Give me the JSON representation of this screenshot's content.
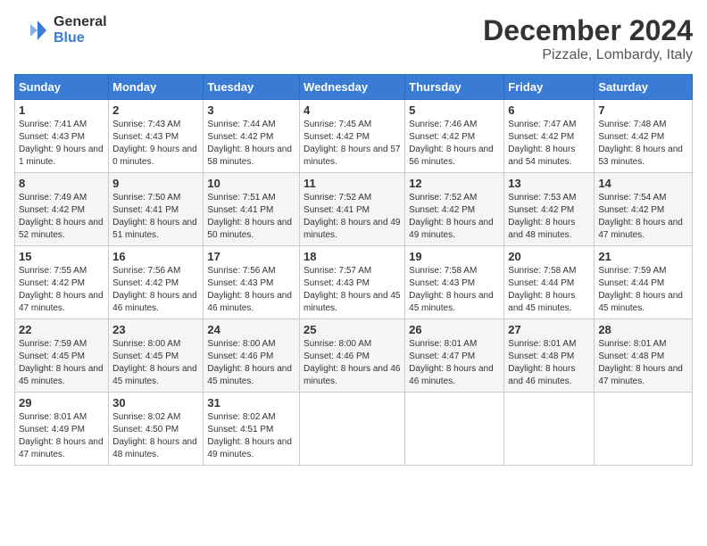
{
  "header": {
    "logo_general": "General",
    "logo_blue": "Blue",
    "month": "December 2024",
    "location": "Pizzale, Lombardy, Italy"
  },
  "days_of_week": [
    "Sunday",
    "Monday",
    "Tuesday",
    "Wednesday",
    "Thursday",
    "Friday",
    "Saturday"
  ],
  "weeks": [
    [
      {
        "day": "1",
        "sunrise": "7:41 AM",
        "sunset": "4:43 PM",
        "daylight": "9 hours and 1 minute."
      },
      {
        "day": "2",
        "sunrise": "7:43 AM",
        "sunset": "4:43 PM",
        "daylight": "9 hours and 0 minutes."
      },
      {
        "day": "3",
        "sunrise": "7:44 AM",
        "sunset": "4:42 PM",
        "daylight": "8 hours and 58 minutes."
      },
      {
        "day": "4",
        "sunrise": "7:45 AM",
        "sunset": "4:42 PM",
        "daylight": "8 hours and 57 minutes."
      },
      {
        "day": "5",
        "sunrise": "7:46 AM",
        "sunset": "4:42 PM",
        "daylight": "8 hours and 56 minutes."
      },
      {
        "day": "6",
        "sunrise": "7:47 AM",
        "sunset": "4:42 PM",
        "daylight": "8 hours and 54 minutes."
      },
      {
        "day": "7",
        "sunrise": "7:48 AM",
        "sunset": "4:42 PM",
        "daylight": "8 hours and 53 minutes."
      }
    ],
    [
      {
        "day": "8",
        "sunrise": "7:49 AM",
        "sunset": "4:42 PM",
        "daylight": "8 hours and 52 minutes."
      },
      {
        "day": "9",
        "sunrise": "7:50 AM",
        "sunset": "4:41 PM",
        "daylight": "8 hours and 51 minutes."
      },
      {
        "day": "10",
        "sunrise": "7:51 AM",
        "sunset": "4:41 PM",
        "daylight": "8 hours and 50 minutes."
      },
      {
        "day": "11",
        "sunrise": "7:52 AM",
        "sunset": "4:41 PM",
        "daylight": "8 hours and 49 minutes."
      },
      {
        "day": "12",
        "sunrise": "7:52 AM",
        "sunset": "4:42 PM",
        "daylight": "8 hours and 49 minutes."
      },
      {
        "day": "13",
        "sunrise": "7:53 AM",
        "sunset": "4:42 PM",
        "daylight": "8 hours and 48 minutes."
      },
      {
        "day": "14",
        "sunrise": "7:54 AM",
        "sunset": "4:42 PM",
        "daylight": "8 hours and 47 minutes."
      }
    ],
    [
      {
        "day": "15",
        "sunrise": "7:55 AM",
        "sunset": "4:42 PM",
        "daylight": "8 hours and 47 minutes."
      },
      {
        "day": "16",
        "sunrise": "7:56 AM",
        "sunset": "4:42 PM",
        "daylight": "8 hours and 46 minutes."
      },
      {
        "day": "17",
        "sunrise": "7:56 AM",
        "sunset": "4:43 PM",
        "daylight": "8 hours and 46 minutes."
      },
      {
        "day": "18",
        "sunrise": "7:57 AM",
        "sunset": "4:43 PM",
        "daylight": "8 hours and 45 minutes."
      },
      {
        "day": "19",
        "sunrise": "7:58 AM",
        "sunset": "4:43 PM",
        "daylight": "8 hours and 45 minutes."
      },
      {
        "day": "20",
        "sunrise": "7:58 AM",
        "sunset": "4:44 PM",
        "daylight": "8 hours and 45 minutes."
      },
      {
        "day": "21",
        "sunrise": "7:59 AM",
        "sunset": "4:44 PM",
        "daylight": "8 hours and 45 minutes."
      }
    ],
    [
      {
        "day": "22",
        "sunrise": "7:59 AM",
        "sunset": "4:45 PM",
        "daylight": "8 hours and 45 minutes."
      },
      {
        "day": "23",
        "sunrise": "8:00 AM",
        "sunset": "4:45 PM",
        "daylight": "8 hours and 45 minutes."
      },
      {
        "day": "24",
        "sunrise": "8:00 AM",
        "sunset": "4:46 PM",
        "daylight": "8 hours and 45 minutes."
      },
      {
        "day": "25",
        "sunrise": "8:00 AM",
        "sunset": "4:46 PM",
        "daylight": "8 hours and 46 minutes."
      },
      {
        "day": "26",
        "sunrise": "8:01 AM",
        "sunset": "4:47 PM",
        "daylight": "8 hours and 46 minutes."
      },
      {
        "day": "27",
        "sunrise": "8:01 AM",
        "sunset": "4:48 PM",
        "daylight": "8 hours and 46 minutes."
      },
      {
        "day": "28",
        "sunrise": "8:01 AM",
        "sunset": "4:48 PM",
        "daylight": "8 hours and 47 minutes."
      }
    ],
    [
      {
        "day": "29",
        "sunrise": "8:01 AM",
        "sunset": "4:49 PM",
        "daylight": "8 hours and 47 minutes."
      },
      {
        "day": "30",
        "sunrise": "8:02 AM",
        "sunset": "4:50 PM",
        "daylight": "8 hours and 48 minutes."
      },
      {
        "day": "31",
        "sunrise": "8:02 AM",
        "sunset": "4:51 PM",
        "daylight": "8 hours and 49 minutes."
      },
      null,
      null,
      null,
      null
    ]
  ],
  "labels": {
    "sunrise": "Sunrise:",
    "sunset": "Sunset:",
    "daylight": "Daylight:"
  }
}
